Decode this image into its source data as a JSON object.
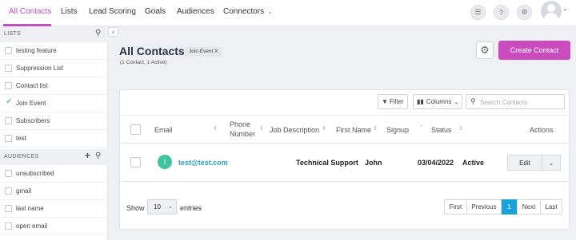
{
  "nav": {
    "items": [
      "All Contacts",
      "Lists",
      "Lead Scoring",
      "Goals",
      "Audiences",
      "Connectors"
    ],
    "accent": "#c04fbf"
  },
  "sidebar": {
    "lists_title": "LISTS",
    "lists": [
      {
        "label": "testing feature",
        "checked": false
      },
      {
        "label": "Suppression List",
        "checked": false
      },
      {
        "label": "Contact list",
        "checked": false
      },
      {
        "label": "Join Event",
        "checked": true
      },
      {
        "label": "Subscribers",
        "checked": false
      },
      {
        "label": "test",
        "checked": false
      }
    ],
    "audiences_title": "AUDIENCES",
    "audiences": [
      "unsubscribed",
      "gmail",
      "last name",
      "open email"
    ]
  },
  "page": {
    "title": "All Contacts",
    "filter_tag": "Join Event X",
    "count": "(1 Contact, 1 Active)",
    "create_label": "Create Contact",
    "create_color": "#c94bbd"
  },
  "toolbar": {
    "filter_label": "Filter",
    "columns_label": "Columns",
    "search_placeholder": "Search Contacts"
  },
  "table": {
    "headers": [
      "Email",
      "Phone Number",
      "Job Description",
      "First Name",
      "Signup",
      "Status",
      "Actions"
    ],
    "rows": [
      {
        "initial": "I",
        "email": "test@test.com",
        "phone": "",
        "job": "Technical Support",
        "first_name": "John",
        "signup": "03/04/2022",
        "status": "Active",
        "action": "Edit"
      }
    ]
  },
  "footer": {
    "show_label": "Show",
    "entries_value": "10",
    "entries_label": "entries",
    "pages": [
      "First",
      "Previous",
      "1",
      "Next",
      "Last"
    ]
  }
}
